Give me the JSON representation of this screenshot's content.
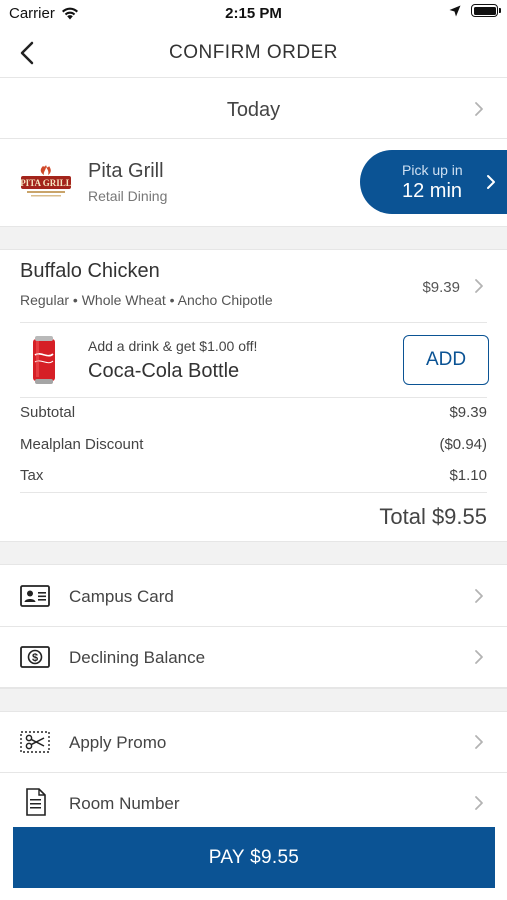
{
  "status_bar": {
    "carrier": "Carrier",
    "time": "2:15 PM"
  },
  "header": {
    "title": "CONFIRM ORDER"
  },
  "schedule": {
    "label": "Today"
  },
  "store": {
    "name": "Pita Grill",
    "subtitle": "Retail Dining",
    "logo_text": "PITA GRILL",
    "pickup_label": "Pick up in",
    "pickup_value": "12 min"
  },
  "order_item": {
    "name": "Buffalo Chicken",
    "options": "Regular • Whole Wheat • Ancho Chipotle",
    "price": "$9.39"
  },
  "drink_upsell": {
    "promo": "Add a drink & get $1.00 off!",
    "name": "Coca-Cola Bottle",
    "add_label": "ADD"
  },
  "summary": {
    "subtotal_label": "Subtotal",
    "subtotal_value": "$9.39",
    "discount_label": "Mealplan Discount",
    "discount_value": "($0.94)",
    "tax_label": "Tax",
    "tax_value": "$1.10",
    "total": "Total $9.55"
  },
  "payment_methods": [
    {
      "label": "Campus Card",
      "icon": "id-card-icon"
    },
    {
      "label": "Declining Balance",
      "icon": "dollar-bill-icon"
    }
  ],
  "extras": [
    {
      "label": "Apply Promo",
      "icon": "scissors-coupon-icon"
    },
    {
      "label": "Room Number",
      "icon": "document-icon"
    }
  ],
  "pay_button": {
    "label": "PAY $9.55"
  },
  "colors": {
    "accent": "#0b5394",
    "background_gap": "#f2f2f2",
    "divider": "#e6e6e6"
  }
}
